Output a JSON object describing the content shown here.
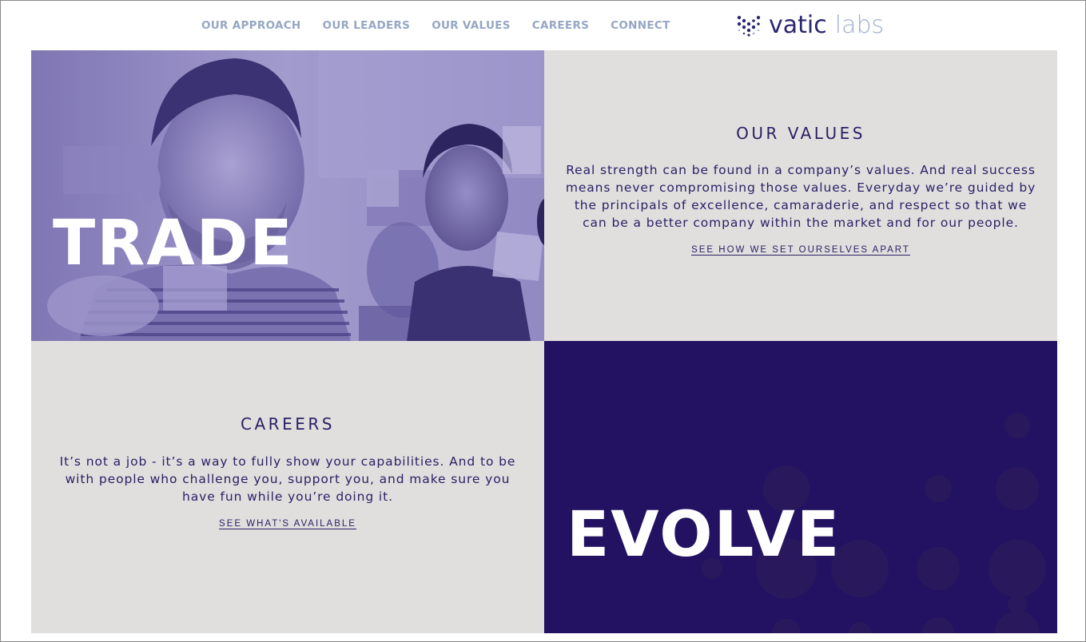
{
  "nav": {
    "items": [
      {
        "label": "OUR APPROACH"
      },
      {
        "label": "OUR LEADERS"
      },
      {
        "label": "OUR VALUES"
      },
      {
        "label": "CAREERS"
      },
      {
        "label": "CONNECT"
      }
    ],
    "color": "#95a7c4"
  },
  "logo": {
    "word1": "vatic",
    "word2": "labs",
    "primary_color": "#2b2770",
    "secondary_color": "#9fb0cc"
  },
  "tiles": {
    "trade": {
      "word": "TRADE",
      "overlay_color": "#8b82bd"
    },
    "values": {
      "heading": "OUR VALUES",
      "body": "Real strength can be found in a company’s values. And real success means never compromising those values. Everyday we’re guided by the principals of excellence, camaraderie, and respect so that we can be a better company within the market and for our people.",
      "link": "SEE HOW WE SET OURSELVES APART",
      "background": "#e0dfdd"
    },
    "careers": {
      "heading": "CAREERS",
      "body": "It’s not a job - it’s a way to fully show your capabilities. And to be with people who challenge you, support you, and make sure you have fun while you’re doing it.",
      "link": "SEE WHAT'S AVAILABLE",
      "background": "#e0dfdd"
    },
    "evolve": {
      "word": "EVOLVE",
      "background": "#231162"
    }
  },
  "text_color": "#2a2166"
}
